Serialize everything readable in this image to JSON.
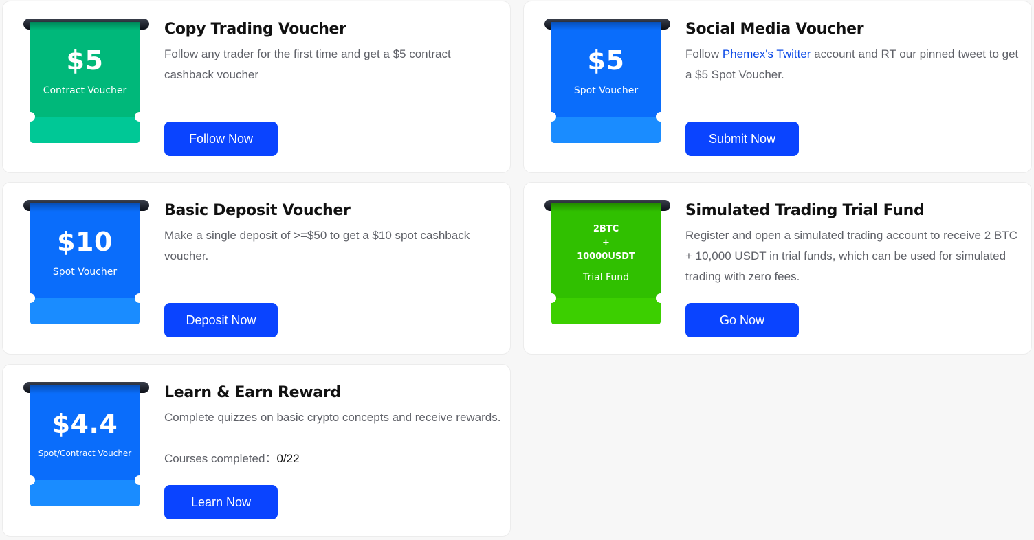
{
  "colors": {
    "button": "#0a44ff",
    "link": "#0a48e6",
    "blue_ticket": "#0a6dfb",
    "green_ticket": "#00b87a",
    "lime_ticket": "#30c000"
  },
  "cards": [
    {
      "title": "Copy Trading Voucher",
      "description": "Follow any trader for the first time and get a $5 contract cashback voucher",
      "ticket_amount": "$5",
      "ticket_label": "Contract Voucher",
      "button": "Follow Now"
    },
    {
      "title": "Social Media Voucher",
      "description_prefix": "Follow ",
      "description_link": "Phemex's Twitter",
      "description_suffix": " account and RT our pinned tweet to get a $5 Spot Voucher.",
      "ticket_amount": "$5",
      "ticket_label": "Spot Voucher",
      "button": "Submit Now"
    },
    {
      "title": "Basic Deposit Voucher",
      "description": "Make a single deposit of >=$50 to get a $10 spot cashback voucher.",
      "ticket_amount": "$10",
      "ticket_label": "Spot Voucher",
      "button": "Deposit Now"
    },
    {
      "title": "Simulated Trading Trial Fund",
      "description": "Register and open a simulated trading account to receive 2 BTC + 10,000 USDT in trial funds, which can be used for simulated trading with zero fees.",
      "ticket_line1": "2BTC",
      "ticket_line2": "+",
      "ticket_line3": "10000USDT",
      "ticket_label": "Trial Fund",
      "button": "Go Now"
    },
    {
      "title": "Learn & Earn Reward",
      "description": "Complete quizzes on basic crypto concepts and receive rewards.",
      "progress_label": "Courses completed：",
      "progress_value": "0/22",
      "ticket_amount": "$4.4",
      "ticket_label": "Spot/Contract Voucher",
      "button": "Learn Now"
    }
  ]
}
